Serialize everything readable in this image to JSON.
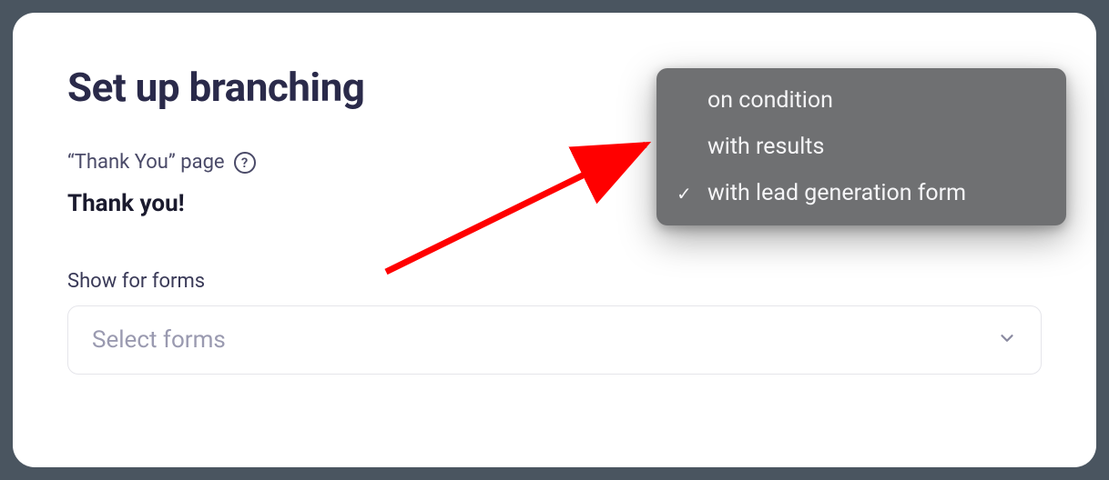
{
  "heading": "Set up branching",
  "page_label": "“Thank You” page",
  "page_name": "Thank you!",
  "field_label": "Show for forms",
  "select_placeholder": "Select forms",
  "dropdown": {
    "items": [
      {
        "label": "on condition",
        "checked": false
      },
      {
        "label": "with results",
        "checked": false
      },
      {
        "label": "with lead generation form",
        "checked": true
      }
    ]
  }
}
